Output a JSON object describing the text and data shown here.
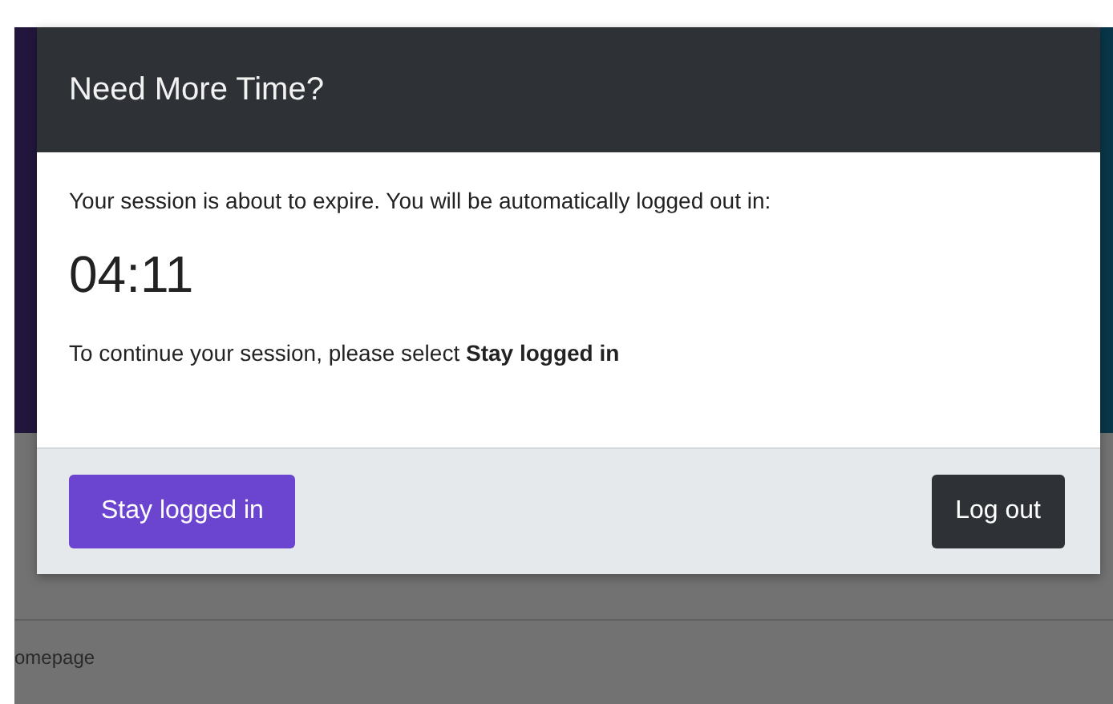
{
  "page": {
    "breadcrumb": "omepage"
  },
  "dialog": {
    "title": "Need More Time?",
    "message": "Your session is about to expire. You will be automatically logged out in:",
    "countdown": "04:11",
    "instruction": "To continue your session, please select **Stay logged in**",
    "buttons": [
      {
        "label": "Stay logged in",
        "kind": "primary"
      },
      {
        "label": "Log out",
        "kind": "dark"
      }
    ]
  }
}
